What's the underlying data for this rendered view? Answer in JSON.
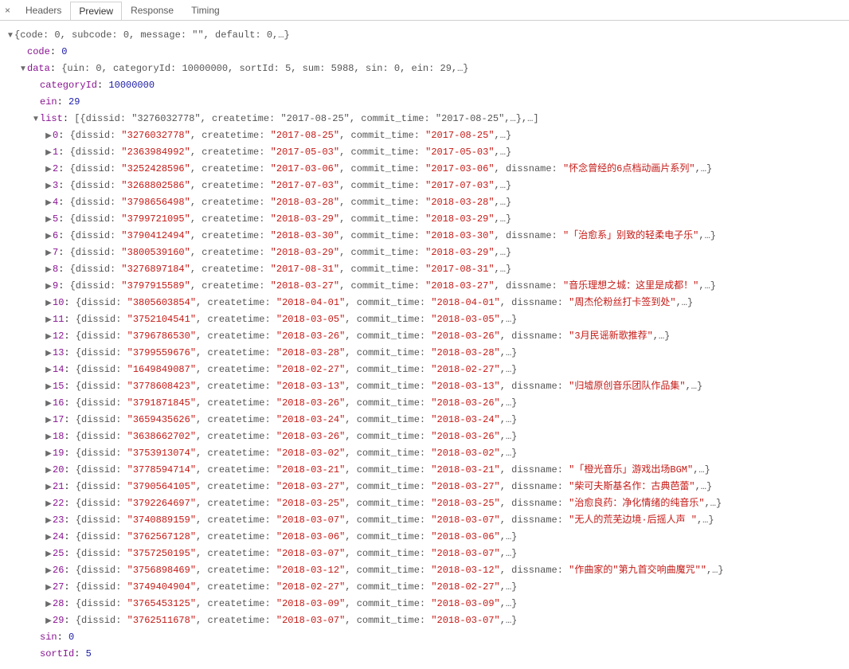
{
  "tabs": {
    "headers": "Headers",
    "preview": "Preview",
    "response": "Response",
    "timing": "Timing",
    "active": "preview"
  },
  "root_summary": "{code: 0, subcode: 0, message: \"\", default: 0,…}",
  "code_key": "code",
  "code_val": "0",
  "data_key": "data",
  "data_summary": "{uin: 0, categoryId: 10000000, sortId: 5, sum: 5988, sin: 0, ein: 29,…}",
  "categoryId_key": "categoryId",
  "categoryId_val": "10000000",
  "ein_key": "ein",
  "ein_val": "29",
  "list_key": "list",
  "list_summary": "[{dissid: \"3276032778\", createtime: \"2017-08-25\", commit_time: \"2017-08-25\",…},…]",
  "sin_key": "sin",
  "sin_val": "0",
  "sortId_key": "sortId",
  "sortId_val": "5",
  "list": [
    {
      "idx": "0",
      "dissid": "3276032778",
      "createtime": "2017-08-25",
      "commit_time": "2017-08-25"
    },
    {
      "idx": "1",
      "dissid": "2363984992",
      "createtime": "2017-05-03",
      "commit_time": "2017-05-03"
    },
    {
      "idx": "2",
      "dissid": "3252428596",
      "createtime": "2017-03-06",
      "commit_time": "2017-03-06",
      "dissname": "怀念曾经的6点档动画片系列"
    },
    {
      "idx": "3",
      "dissid": "3268802586",
      "createtime": "2017-07-03",
      "commit_time": "2017-07-03"
    },
    {
      "idx": "4",
      "dissid": "3798656498",
      "createtime": "2018-03-28",
      "commit_time": "2018-03-28"
    },
    {
      "idx": "5",
      "dissid": "3799721095",
      "createtime": "2018-03-29",
      "commit_time": "2018-03-29"
    },
    {
      "idx": "6",
      "dissid": "3790412494",
      "createtime": "2018-03-30",
      "commit_time": "2018-03-30",
      "dissname": "「治愈系」别致的轻柔电子乐"
    },
    {
      "idx": "7",
      "dissid": "3800539160",
      "createtime": "2018-03-29",
      "commit_time": "2018-03-29"
    },
    {
      "idx": "8",
      "dissid": "3276897184",
      "createtime": "2017-08-31",
      "commit_time": "2017-08-31"
    },
    {
      "idx": "9",
      "dissid": "3797915589",
      "createtime": "2018-03-27",
      "commit_time": "2018-03-27",
      "dissname": "音乐理想之城：这里是成都！"
    },
    {
      "idx": "10",
      "dissid": "3805603854",
      "createtime": "2018-04-01",
      "commit_time": "2018-04-01",
      "dissname": "周杰伦粉丝打卡签到处"
    },
    {
      "idx": "11",
      "dissid": "3752104541",
      "createtime": "2018-03-05",
      "commit_time": "2018-03-05"
    },
    {
      "idx": "12",
      "dissid": "3796786530",
      "createtime": "2018-03-26",
      "commit_time": "2018-03-26",
      "dissname": "3月民谣新歌推荐"
    },
    {
      "idx": "13",
      "dissid": "3799559676",
      "createtime": "2018-03-28",
      "commit_time": "2018-03-28"
    },
    {
      "idx": "14",
      "dissid": "1649849087",
      "createtime": "2018-02-27",
      "commit_time": "2018-02-27"
    },
    {
      "idx": "15",
      "dissid": "3778608423",
      "createtime": "2018-03-13",
      "commit_time": "2018-03-13",
      "dissname": "归墟原创音乐团队作品集"
    },
    {
      "idx": "16",
      "dissid": "3791871845",
      "createtime": "2018-03-26",
      "commit_time": "2018-03-26"
    },
    {
      "idx": "17",
      "dissid": "3659435626",
      "createtime": "2018-03-24",
      "commit_time": "2018-03-24"
    },
    {
      "idx": "18",
      "dissid": "3638662702",
      "createtime": "2018-03-26",
      "commit_time": "2018-03-26"
    },
    {
      "idx": "19",
      "dissid": "3753913074",
      "createtime": "2018-03-02",
      "commit_time": "2018-03-02"
    },
    {
      "idx": "20",
      "dissid": "3778594714",
      "createtime": "2018-03-21",
      "commit_time": "2018-03-21",
      "dissname": "「橙光音乐」游戏出场BGM"
    },
    {
      "idx": "21",
      "dissid": "3790564105",
      "createtime": "2018-03-27",
      "commit_time": "2018-03-27",
      "dissname": "柴可夫斯基名作：古典芭蕾"
    },
    {
      "idx": "22",
      "dissid": "3792264697",
      "createtime": "2018-03-25",
      "commit_time": "2018-03-25",
      "dissname": "治愈良药：净化情绪的纯音乐"
    },
    {
      "idx": "23",
      "dissid": "3740889159",
      "createtime": "2018-03-07",
      "commit_time": "2018-03-07",
      "dissname": "无人的荒芜边境·后摇人声 "
    },
    {
      "idx": "24",
      "dissid": "3762567128",
      "createtime": "2018-03-06",
      "commit_time": "2018-03-06"
    },
    {
      "idx": "25",
      "dissid": "3757250195",
      "createtime": "2018-03-07",
      "commit_time": "2018-03-07"
    },
    {
      "idx": "26",
      "dissid": "3756898469",
      "createtime": "2018-03-12",
      "commit_time": "2018-03-12",
      "dissname": "作曲家的\"第九首交响曲魔咒\""
    },
    {
      "idx": "27",
      "dissid": "3749404904",
      "createtime": "2018-02-27",
      "commit_time": "2018-02-27"
    },
    {
      "idx": "28",
      "dissid": "3765453125",
      "createtime": "2018-03-09",
      "commit_time": "2018-03-09"
    },
    {
      "idx": "29",
      "dissid": "3762511678",
      "createtime": "2018-03-07",
      "commit_time": "2018-03-07"
    }
  ]
}
